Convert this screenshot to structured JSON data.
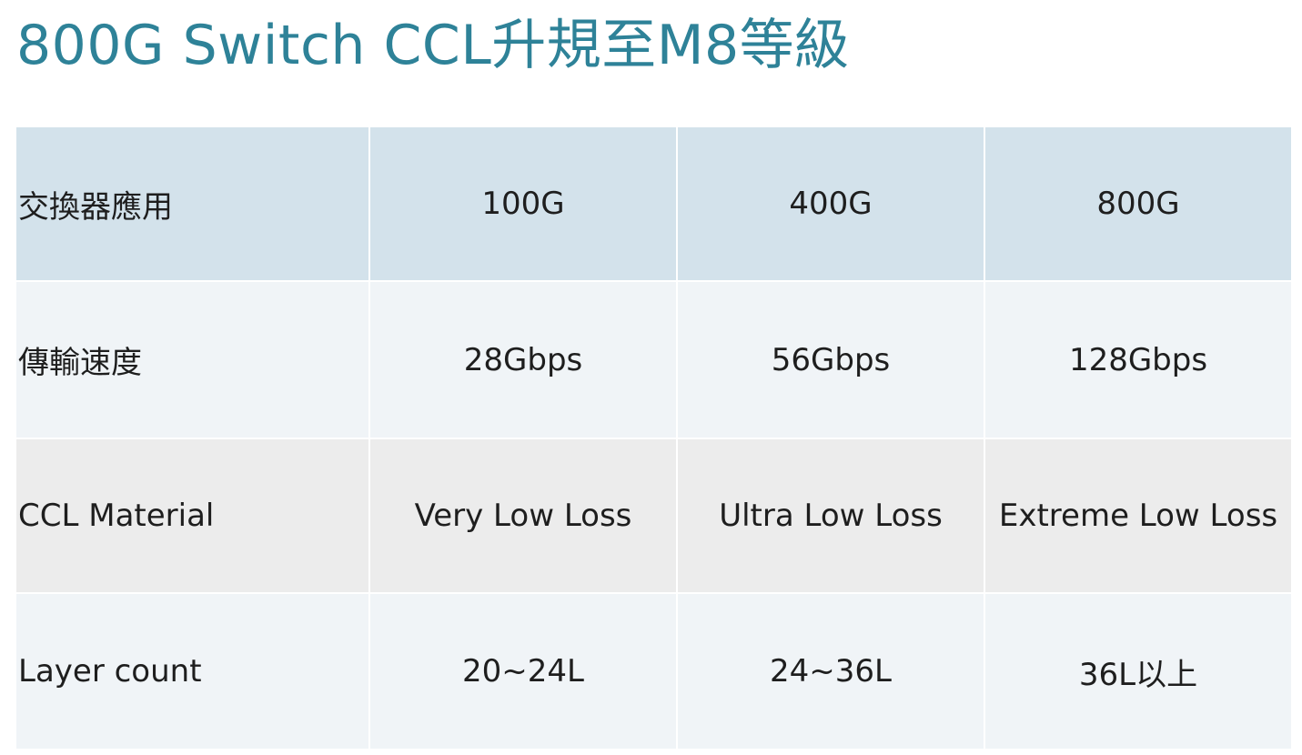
{
  "title": "800G Switch CCL升規至M8等級",
  "table": {
    "header": {
      "label": "交換器應用",
      "cols": [
        "100G",
        "400G",
        "800G"
      ]
    },
    "rows": [
      {
        "label": "傳輸速度",
        "values": [
          "28Gbps",
          "56Gbps",
          "128Gbps"
        ]
      },
      {
        "label": "CCL Material",
        "values": [
          "Very Low Loss",
          "Ultra Low Loss",
          "Extreme Low Loss"
        ]
      },
      {
        "label": "Layer count",
        "values": [
          "20~24L",
          "24~36L",
          "36L以上"
        ]
      }
    ]
  },
  "colors": {
    "title": "#2e8298",
    "header_bg": "#d3e2eb",
    "row_light_bg": "#f0f4f7",
    "row_grey_bg": "#ececec"
  }
}
